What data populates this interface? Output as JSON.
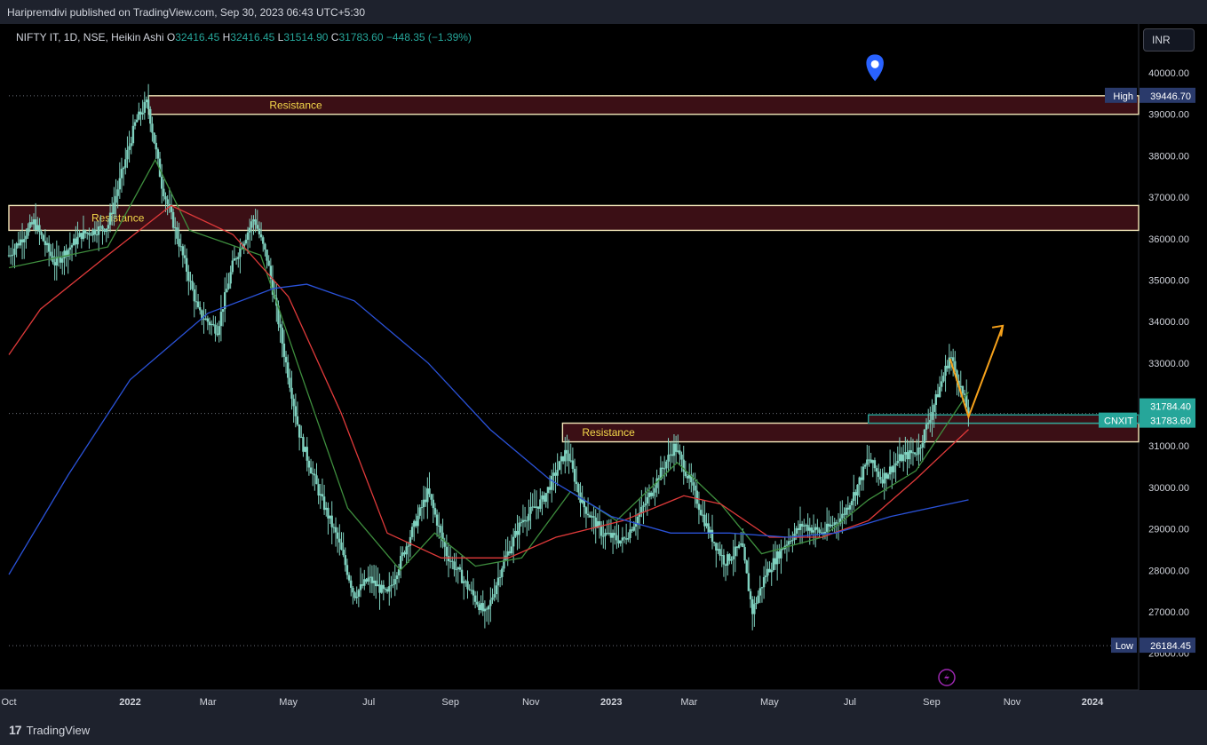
{
  "header": {
    "publish_line": "Haripremdivi published on TradingView.com, Sep 30, 2023 06:43 UTC+5:30"
  },
  "legend": {
    "symbol": "NIFTY IT, 1D, NSE, Heikin Ashi",
    "o_label": "O",
    "o": "32416.45",
    "h_label": "H",
    "h": "32416.45",
    "l_label": "L",
    "l": "31514.90",
    "c_label": "C",
    "c": "31783.60",
    "change": "−448.35 (−1.39%)"
  },
  "currency_button": "INR",
  "footer": {
    "brand": "TradingView"
  },
  "colors": {
    "background": "#000000",
    "candle": "#7fd1bf",
    "zone_fill": "#3b0f15",
    "zone_border": "#f2e6b8",
    "zone_label": "#f5d94a",
    "ema_fast": "#3e8e3e",
    "ema_mid": "#e03a3a",
    "ema_slow": "#2a52d8",
    "arrow": "#f7a21b",
    "high_low_badge": "#2a3a6b",
    "last_price_badge": "#26a69a"
  },
  "chart_data": {
    "type": "candlestick",
    "style": "Heikin Ashi",
    "ylim": [
      25200,
      41000
    ],
    "y_ticks": [
      "26000.00",
      "27000.00",
      "28000.00",
      "29000.00",
      "30000.00",
      "31000.00",
      "32000.00",
      "33000.00",
      "34000.00",
      "35000.00",
      "36000.00",
      "37000.00",
      "38000.00",
      "39000.00",
      "40000.00"
    ],
    "x_ticks": [
      {
        "label": "Oct",
        "date": "2021-10-01"
      },
      {
        "label": "2022",
        "date": "2022-01-01"
      },
      {
        "label": "Mar",
        "date": "2022-03-01"
      },
      {
        "label": "May",
        "date": "2022-05-01"
      },
      {
        "label": "Jul",
        "date": "2022-07-01"
      },
      {
        "label": "Sep",
        "date": "2022-09-01"
      },
      {
        "label": "Nov",
        "date": "2022-11-01"
      },
      {
        "label": "2023",
        "date": "2023-01-01"
      },
      {
        "label": "Mar",
        "date": "2023-03-01"
      },
      {
        "label": "May",
        "date": "2023-05-01"
      },
      {
        "label": "Jul",
        "date": "2023-07-01"
      },
      {
        "label": "Sep",
        "date": "2023-09-01"
      },
      {
        "label": "Nov",
        "date": "2023-11-01"
      },
      {
        "label": "2024",
        "date": "2024-01-01"
      }
    ],
    "x_range": [
      "2021-10-01",
      "2024-02-05"
    ],
    "price_path": [
      [
        "2021-10-01",
        35600
      ],
      [
        "2021-10-20",
        36400
      ],
      [
        "2021-11-05",
        35400
      ],
      [
        "2021-11-25",
        36100
      ],
      [
        "2021-12-15",
        36300
      ],
      [
        "2022-01-05",
        38800
      ],
      [
        "2022-01-14",
        39300
      ],
      [
        "2022-01-25",
        37300
      ],
      [
        "2022-02-08",
        35800
      ],
      [
        "2022-02-22",
        34200
      ],
      [
        "2022-03-08",
        33800
      ],
      [
        "2022-03-20",
        35400
      ],
      [
        "2022-04-05",
        36500
      ],
      [
        "2022-04-15",
        35500
      ],
      [
        "2022-04-28",
        33200
      ],
      [
        "2022-05-10",
        31200
      ],
      [
        "2022-05-25",
        29800
      ],
      [
        "2022-06-08",
        28700
      ],
      [
        "2022-06-20",
        27400
      ],
      [
        "2022-07-01",
        27800
      ],
      [
        "2022-07-15",
        27400
      ],
      [
        "2022-08-01",
        28800
      ],
      [
        "2022-08-15",
        29900
      ],
      [
        "2022-08-29",
        28400
      ],
      [
        "2022-09-10",
        27800
      ],
      [
        "2022-09-28",
        26900
      ],
      [
        "2022-10-10",
        28100
      ],
      [
        "2022-10-25",
        29200
      ],
      [
        "2022-11-10",
        29700
      ],
      [
        "2022-11-28",
        30900
      ],
      [
        "2022-12-10",
        29600
      ],
      [
        "2022-12-25",
        28900
      ],
      [
        "2023-01-10",
        28700
      ],
      [
        "2023-01-25",
        29500
      ],
      [
        "2023-02-08",
        30400
      ],
      [
        "2023-02-18",
        31000
      ],
      [
        "2023-03-01",
        30200
      ],
      [
        "2023-03-15",
        29000
      ],
      [
        "2023-03-28",
        28200
      ],
      [
        "2023-04-10",
        28600
      ],
      [
        "2023-04-18",
        27000
      ],
      [
        "2023-04-28",
        27900
      ],
      [
        "2023-05-12",
        28600
      ],
      [
        "2023-05-26",
        29100
      ],
      [
        "2023-06-10",
        28900
      ],
      [
        "2023-06-25",
        29300
      ],
      [
        "2023-07-05",
        29900
      ],
      [
        "2023-07-15",
        30700
      ],
      [
        "2023-07-25",
        30200
      ],
      [
        "2023-08-08",
        30700
      ],
      [
        "2023-08-22",
        30900
      ],
      [
        "2023-09-05",
        32200
      ],
      [
        "2023-09-15",
        33200
      ],
      [
        "2023-09-29",
        31800
      ]
    ],
    "moving_averages": [
      {
        "color_key": "ema_fast",
        "points": [
          [
            "2021-10-01",
            35300
          ],
          [
            "2021-12-15",
            35800
          ],
          [
            "2022-01-20",
            37900
          ],
          [
            "2022-02-15",
            36200
          ],
          [
            "2022-04-10",
            35600
          ],
          [
            "2022-05-10",
            32800
          ],
          [
            "2022-06-15",
            29500
          ],
          [
            "2022-07-25",
            28000
          ],
          [
            "2022-08-20",
            28900
          ],
          [
            "2022-09-20",
            28100
          ],
          [
            "2022-10-25",
            28300
          ],
          [
            "2022-12-01",
            29900
          ],
          [
            "2023-01-05",
            29200
          ],
          [
            "2023-02-20",
            30600
          ],
          [
            "2023-03-25",
            29600
          ],
          [
            "2023-04-25",
            28400
          ],
          [
            "2023-06-10",
            28800
          ],
          [
            "2023-07-15",
            29700
          ],
          [
            "2023-08-20",
            30400
          ],
          [
            "2023-09-29",
            32300
          ]
        ]
      },
      {
        "color_key": "ema_mid",
        "points": [
          [
            "2021-10-01",
            33200
          ],
          [
            "2021-10-25",
            34300
          ],
          [
            "2021-12-15",
            35600
          ],
          [
            "2022-02-01",
            36800
          ],
          [
            "2022-03-20",
            36100
          ],
          [
            "2022-05-01",
            34600
          ],
          [
            "2022-06-10",
            31800
          ],
          [
            "2022-07-15",
            28900
          ],
          [
            "2022-08-25",
            28300
          ],
          [
            "2022-10-15",
            28300
          ],
          [
            "2022-11-20",
            28800
          ],
          [
            "2023-01-10",
            29200
          ],
          [
            "2023-02-25",
            29800
          ],
          [
            "2023-03-25",
            29600
          ],
          [
            "2023-05-01",
            28800
          ],
          [
            "2023-06-10",
            28800
          ],
          [
            "2023-07-15",
            29200
          ],
          [
            "2023-08-20",
            30200
          ],
          [
            "2023-09-29",
            31400
          ]
        ]
      },
      {
        "color_key": "ema_slow",
        "points": [
          [
            "2021-10-01",
            27900
          ],
          [
            "2021-11-15",
            30300
          ],
          [
            "2022-01-01",
            32600
          ],
          [
            "2022-03-01",
            34200
          ],
          [
            "2022-04-20",
            34800
          ],
          [
            "2022-05-15",
            34900
          ],
          [
            "2022-06-20",
            34500
          ],
          [
            "2022-08-15",
            33000
          ],
          [
            "2022-10-01",
            31400
          ],
          [
            "2022-11-15",
            30200
          ],
          [
            "2023-01-01",
            29300
          ],
          [
            "2023-02-15",
            28900
          ],
          [
            "2023-04-01",
            28900
          ],
          [
            "2023-05-15",
            28800
          ],
          [
            "2023-06-20",
            28900
          ],
          [
            "2023-08-01",
            29300
          ],
          [
            "2023-09-29",
            29700
          ]
        ]
      }
    ],
    "zones": [
      {
        "label": "Resistance",
        "from": "2022-01-15",
        "to": "2024-02-05",
        "y_low": 39000,
        "y_high": 39446.7
      },
      {
        "label": "Resistance",
        "from": "2021-10-01",
        "to": "2024-02-05",
        "y_low": 36200,
        "y_high": 36800
      },
      {
        "label": "Resistance",
        "from": "2022-11-25",
        "to": "2024-02-05",
        "y_low": 31100,
        "y_high": 31550
      },
      {
        "label": "",
        "from": "2023-07-15",
        "to": "2024-02-05",
        "y_low": 31550,
        "y_high": 31750
      }
    ],
    "projection": [
      [
        "2023-09-15",
        33100
      ],
      [
        "2023-09-29",
        31700
      ],
      [
        "2023-10-25",
        33900
      ]
    ],
    "marker_pin": {
      "date": "2023-07-20",
      "y": 40100
    },
    "price_labels": [
      {
        "name": "High",
        "value": "39446.70",
        "y": 39446.7
      },
      {
        "name": "",
        "value": "31784.40",
        "y": 31784.4
      },
      {
        "name": "CNXIT",
        "value": "31783.60",
        "y": 31783.6
      },
      {
        "name": "Low",
        "value": "26184.45",
        "y": 26184.45
      }
    ]
  }
}
